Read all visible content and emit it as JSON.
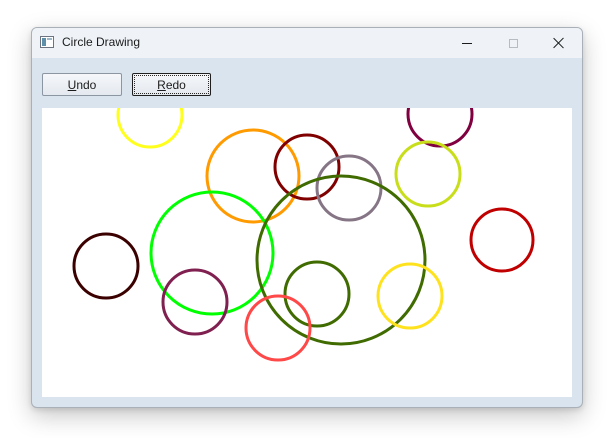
{
  "window": {
    "title": "Circle Drawing",
    "icon": "app-window-icon"
  },
  "toolbar": {
    "undo": {
      "mnemonic": "U",
      "rest": "ndo"
    },
    "redo": {
      "mnemonic": "R",
      "rest": "edo"
    }
  },
  "canvas": {
    "background": "#ffffff",
    "circles": [
      {
        "color": "#ffff1e"
      },
      {
        "color": "#800040"
      },
      {
        "color": "#ff9a00"
      },
      {
        "color": "#800000"
      },
      {
        "color": "#857585"
      },
      {
        "color": "#c8de1a"
      },
      {
        "color": "#00ff00"
      },
      {
        "color": "#3f6b00"
      },
      {
        "color": "#c00000"
      },
      {
        "color": "#3b0000"
      },
      {
        "color": "#802050"
      },
      {
        "color": "#3f6b00"
      },
      {
        "color": "#ffe21e"
      },
      {
        "color": "#ff4848"
      }
    ]
  }
}
